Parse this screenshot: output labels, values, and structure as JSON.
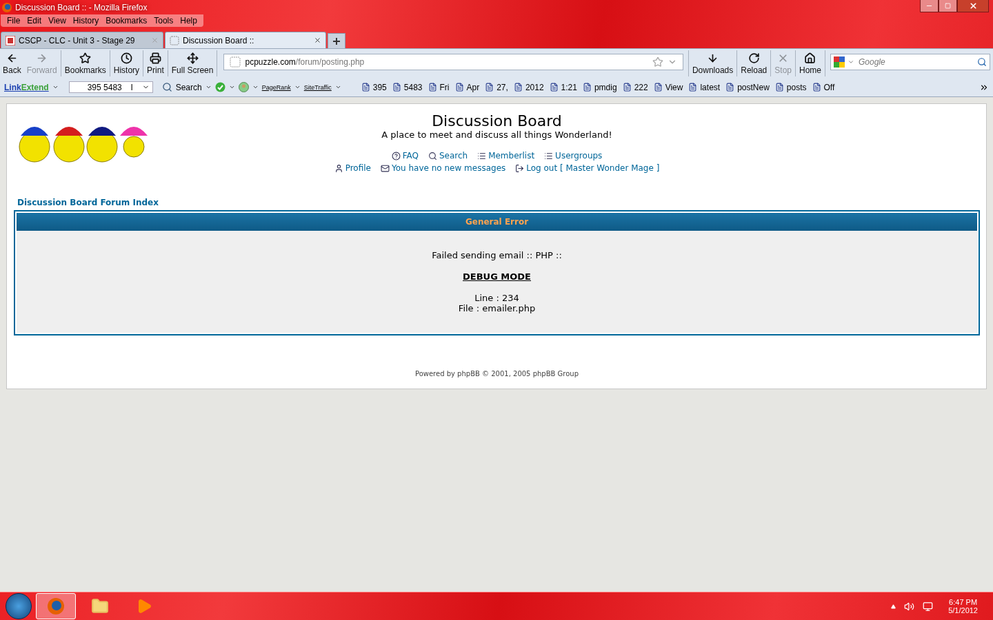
{
  "window": {
    "title": "Discussion Board :: - Mozilla Firefox"
  },
  "menu": [
    "File",
    "Edit",
    "View",
    "History",
    "Bookmarks",
    "Tools",
    "Help"
  ],
  "tabs": [
    {
      "label": "CSCP - CLC - Unit 3 - Stage 29",
      "selected": false
    },
    {
      "label": "Discussion Board ::",
      "selected": true
    }
  ],
  "nav_buttons": [
    {
      "kind": "back",
      "label": "Back",
      "disabled": false
    },
    {
      "kind": "forward",
      "label": "Forward",
      "disabled": true
    },
    {
      "kind": "bookmarks",
      "label": "Bookmarks",
      "disabled": false
    },
    {
      "kind": "history",
      "label": "History",
      "disabled": false
    },
    {
      "kind": "print",
      "label": "Print",
      "disabled": false
    },
    {
      "kind": "fullscreen",
      "label": "Full Screen",
      "disabled": false
    }
  ],
  "address": {
    "domain": "pcpuzzle.com",
    "path": "/forum/posting.php"
  },
  "right_buttons": [
    {
      "kind": "downloads",
      "label": "Downloads",
      "disabled": false
    },
    {
      "kind": "reload",
      "label": "Reload",
      "disabled": false
    },
    {
      "kind": "stop",
      "label": "Stop",
      "disabled": true
    },
    {
      "kind": "home",
      "label": "Home",
      "disabled": false
    }
  ],
  "search": {
    "placeholder": "Google"
  },
  "addon_bar": {
    "brand_a": "Link",
    "brand_b": "Extend",
    "field": "395  5483",
    "field_tail": "I",
    "search": "Search",
    "pagerank": "PageRank",
    "sitetraffic": "SiteTraffic",
    "words": [
      "395",
      "5483",
      "Fri",
      "Apr",
      "27,",
      "2012",
      "1:21",
      "pmdig",
      "222",
      "View",
      "latest",
      "postNew",
      "posts",
      "Off"
    ]
  },
  "page": {
    "title": "Discussion Board",
    "subtitle": "A place to meet and discuss all things Wonderland!",
    "links_row1": [
      {
        "kind": "faq",
        "label": "FAQ"
      },
      {
        "kind": "search",
        "label": "Search"
      },
      {
        "kind": "list",
        "label": "Memberlist"
      },
      {
        "kind": "groups",
        "label": "Usergroups"
      }
    ],
    "links_row2": [
      {
        "kind": "profile",
        "label": "Profile"
      },
      {
        "kind": "messages",
        "label": "You have no new messages"
      },
      {
        "kind": "logout",
        "label": "Log out [ Master Wonder Mage ]"
      }
    ],
    "breadcrumb": "Discussion Board Forum Index",
    "error": {
      "header": "General Error",
      "message": "Failed sending email :: PHP ::",
      "debug": "DEBUG MODE",
      "line": "Line : 234",
      "file": "File : emailer.php"
    },
    "footer": "Powered by phpBB © 2001, 2005 phpBB Group"
  },
  "taskbar": {
    "time": "6:47 PM",
    "date": "5/1/2012"
  }
}
